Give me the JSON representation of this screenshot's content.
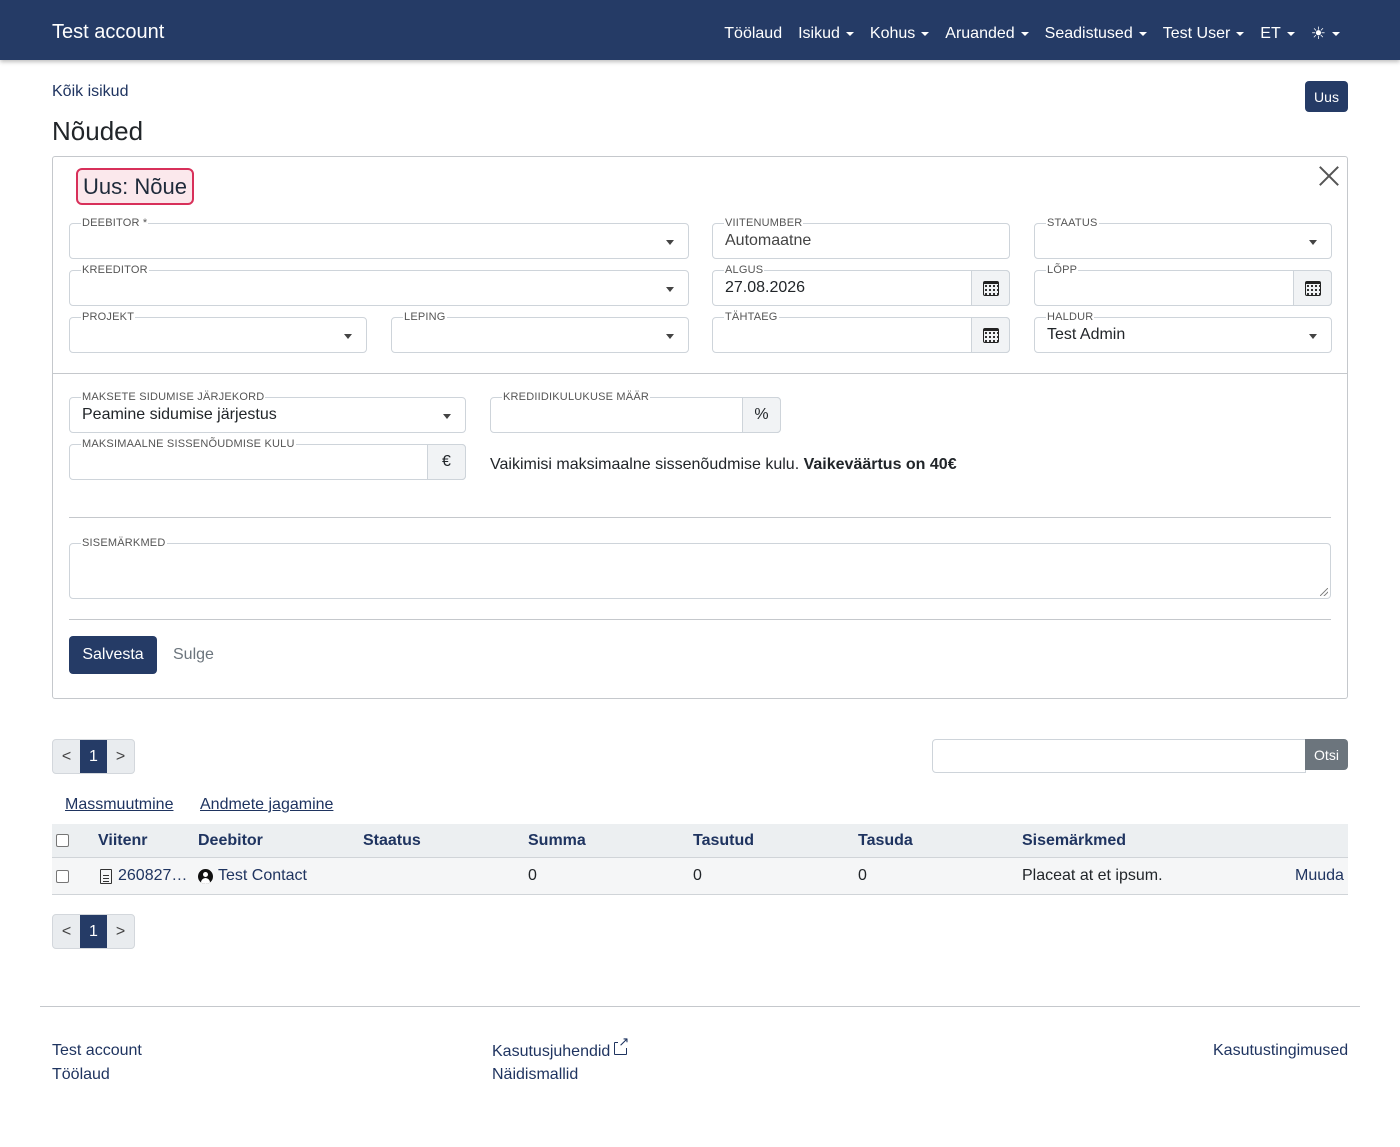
{
  "nav": {
    "brand": "Test account",
    "items": [
      {
        "label": "Töölaud",
        "dropdown": false
      },
      {
        "label": "Isikud",
        "dropdown": true
      },
      {
        "label": "Kohus",
        "dropdown": true
      },
      {
        "label": "Aruanded",
        "dropdown": true
      },
      {
        "label": "Seadistused",
        "dropdown": true
      },
      {
        "label": "Test User",
        "dropdown": true
      },
      {
        "label": "ET",
        "dropdown": true
      }
    ],
    "theme_icon": "☀"
  },
  "header": {
    "breadcrumb": "Kõik isikud",
    "new_button": "Uus",
    "title": "Nõuded"
  },
  "form": {
    "title": "Uus: Nõue",
    "fields": {
      "deebitor": {
        "label": "Deebitor *",
        "value": ""
      },
      "viitenumber": {
        "label": "Viitenumber",
        "value": "Automaatne"
      },
      "staatus": {
        "label": "Staatus",
        "value": ""
      },
      "kreeditor": {
        "label": "Kreeditor",
        "value": ""
      },
      "algus": {
        "label": "Algus",
        "value": "27.08.2026"
      },
      "lopp": {
        "label": "Lõpp",
        "value": ""
      },
      "projekt": {
        "label": "Projekt",
        "value": ""
      },
      "leping": {
        "label": "Leping",
        "value": ""
      },
      "tahtaeg": {
        "label": "Tähtaeg",
        "value": ""
      },
      "haldur": {
        "label": "Haldur",
        "value": "Test Admin"
      },
      "maksete_jarjekord": {
        "label": "Maksete sidumise järjekord",
        "value": "Peamine sidumise järjestus"
      },
      "krediidikulukuse_maar": {
        "label": "Krediidikulukuse määr",
        "value": "",
        "unit": "%"
      },
      "max_kulu": {
        "label": "Maksimaalne sissenõudmise kulu",
        "value": "",
        "unit": "€"
      },
      "sisemarkmed": {
        "label": "Sisemärkmed",
        "value": ""
      }
    },
    "info_text": "Vaikimisi maksimaalne sissenõudmise kulu.",
    "info_bold": "Vaikeväärtus on 40€",
    "save_button": "Salvesta",
    "close_button": "Sulge"
  },
  "pagination": {
    "prev": "<",
    "page": "1",
    "next": ">"
  },
  "search": {
    "placeholder": "",
    "button": "Otsi"
  },
  "actions": {
    "mass_edit": "Massmuutmine",
    "share": "Andmete jagamine"
  },
  "table": {
    "headers": [
      "Viitenr",
      "Deebitor",
      "Staatus",
      "Summa",
      "Tasutud",
      "Tasuda",
      "Sisemärkmed"
    ],
    "rows": [
      {
        "viitenr": "260827…",
        "deebitor": "Test Contact",
        "staatus": "",
        "summa": "0",
        "tasutud": "0",
        "tasuda": "0",
        "sisemarkmed": "Placeat at et ipsum.",
        "action": "Muuda"
      }
    ]
  },
  "footer": {
    "col1": [
      "Test account",
      "Töölaud"
    ],
    "col2": [
      "Kasutusjuhendid",
      "Näidismallid"
    ],
    "col3": [
      "Kasutustingimused"
    ]
  }
}
